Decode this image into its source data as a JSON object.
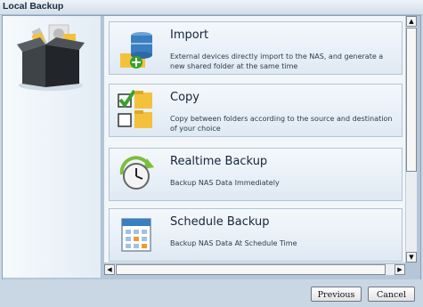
{
  "window": {
    "title": "Local Backup"
  },
  "options": [
    {
      "name": "Import",
      "description": "External devices directly import to the NAS, and generate a new shared folder at the same time",
      "icon": "database-import-icon"
    },
    {
      "name": "Copy",
      "description": "Copy between folders according to the source and destination of your choice",
      "icon": "folder-copy-icon"
    },
    {
      "name": "Realtime Backup",
      "description": "Backup NAS Data Immediately",
      "icon": "clock-sync-icon"
    },
    {
      "name": "Schedule Backup",
      "description": "Backup NAS Data At Schedule Time",
      "icon": "calendar-icon"
    }
  ],
  "buttons": {
    "previous": "Previous",
    "cancel": "Cancel"
  },
  "scrollbars": {
    "up_arrow": "▲",
    "down_arrow": "▼",
    "left_arrow": "◀",
    "right_arrow": "▶"
  },
  "colors": {
    "accent": "#3a7fc0",
    "folder": "#f2c23c",
    "checkmark": "#39a12a"
  }
}
